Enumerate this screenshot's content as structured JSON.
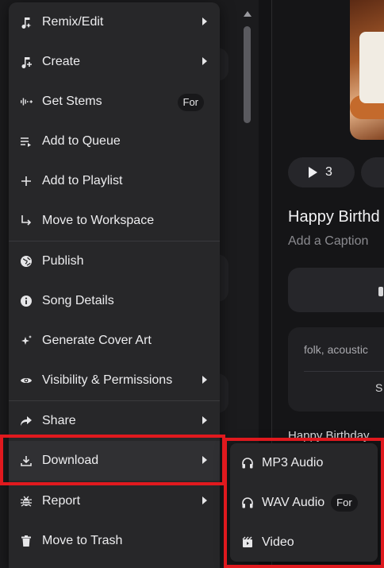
{
  "background": {
    "play_count": "3",
    "song_title": "Happy Birthd",
    "caption_placeholder": "Add a Caption",
    "tags": "folk, acoustic",
    "tag_card_label": "S",
    "lyrics_preview": "Happy Birthday"
  },
  "menu": {
    "items": [
      {
        "label": "Remix/Edit",
        "icon": "remix-icon",
        "submenu": true
      },
      {
        "label": "Create",
        "icon": "create-icon",
        "submenu": true
      },
      {
        "label": "Get Stems",
        "icon": "stems-icon",
        "badge": "For"
      },
      {
        "label": "Add to Queue",
        "icon": "queue-icon"
      },
      {
        "label": "Add to Playlist",
        "icon": "plus-icon"
      },
      {
        "label": "Move to Workspace",
        "icon": "move-arrow-icon"
      },
      {
        "label": "Publish",
        "icon": "globe-icon"
      },
      {
        "label": "Song Details",
        "icon": "info-icon"
      },
      {
        "label": "Generate Cover Art",
        "icon": "sparkle-icon"
      },
      {
        "label": "Visibility & Permissions",
        "icon": "eye-icon",
        "submenu": true
      },
      {
        "label": "Share",
        "icon": "share-icon",
        "submenu": true
      },
      {
        "label": "Download",
        "icon": "download-icon",
        "submenu": true
      },
      {
        "label": "Report",
        "icon": "bug-icon",
        "submenu": true
      },
      {
        "label": "Move to Trash",
        "icon": "trash-icon"
      }
    ]
  },
  "download_submenu": {
    "items": [
      {
        "label": "MP3 Audio",
        "icon": "headphones-icon"
      },
      {
        "label": "WAV Audio",
        "icon": "headphones-icon",
        "badge": "For"
      },
      {
        "label": "Video",
        "icon": "video-icon"
      }
    ]
  },
  "colors": {
    "highlight_box": "#e0191e",
    "menu_bg": "#272729",
    "page_bg": "#131315"
  }
}
